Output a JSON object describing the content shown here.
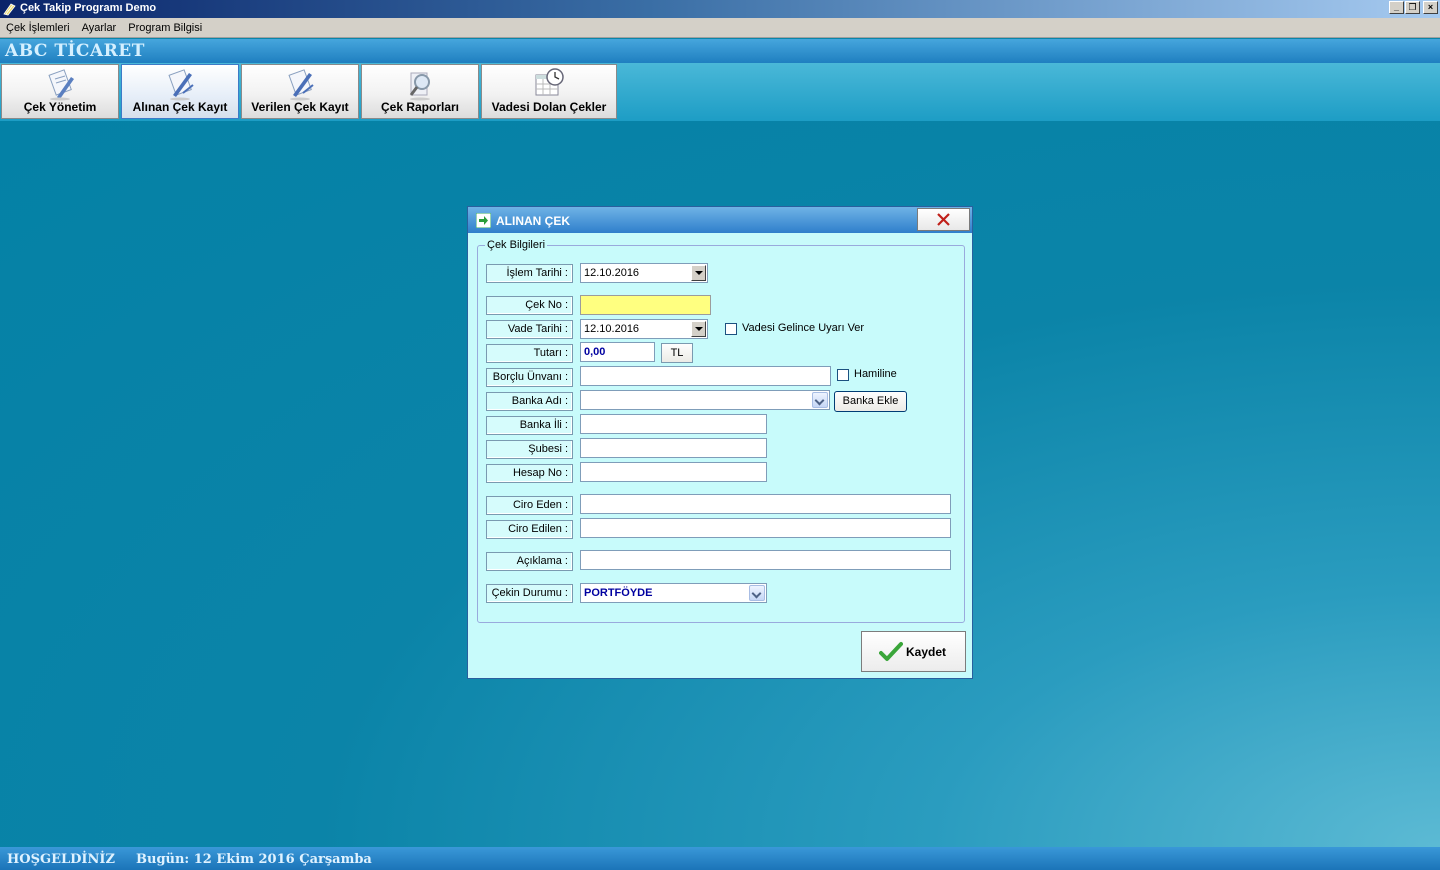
{
  "window": {
    "title": "Çek Takip Programı Demo",
    "controls": [
      "minimize",
      "restore",
      "close"
    ]
  },
  "menu": [
    "Çek İşlemleri",
    "Ayarlar",
    "Program Bilgisi"
  ],
  "company_name": "ABC TİCARET",
  "toolbar": [
    {
      "label": "Çek Yönetim",
      "icon": "document-pencil-icon"
    },
    {
      "label": "Alınan Çek Kayıt",
      "icon": "document-pen-icon"
    },
    {
      "label": "Verilen Çek Kayıt",
      "icon": "document-pen-icon"
    },
    {
      "label": "Çek Raporları",
      "icon": "magnifier-icon"
    },
    {
      "label": "Vadesi Dolan Çekler",
      "icon": "calendar-clock-icon"
    }
  ],
  "status": {
    "welcome": "HOŞGELDİNİZ",
    "today": "Bugün: 12 Ekim 2016 Çarşamba"
  },
  "dialog": {
    "title": "ALINAN ÇEK",
    "group_title": "Çek Bilgileri",
    "labels": {
      "islem_tarihi": "İşlem Tarihi :",
      "cek_no": "Çek No :",
      "vade_tarihi": "Vade Tarihi :",
      "tutari": "Tutarı :",
      "borclu_unvani": "Borçlu Ünvanı :",
      "banka_adi": "Banka Adı :",
      "banka_ili": "Banka İli :",
      "subesi": "Şubesi :",
      "hesap_no": "Hesap No :",
      "ciro_eden": "Ciro Eden :",
      "ciro_edilen": "Ciro Edilen :",
      "aciklama": "Açıklama :",
      "cekin_durumu": "Çekin Durumu :"
    },
    "values": {
      "islem_tarihi": "12.10.2016",
      "cek_no": "",
      "vade_tarihi": "12.10.2016",
      "tutari": "0,00",
      "currency": "TL",
      "borclu_unvani": "",
      "banka_adi": "",
      "banka_ili": "",
      "subesi": "",
      "hesap_no": "",
      "ciro_eden": "",
      "ciro_edilen": "",
      "aciklama": "",
      "cekin_durumu": "PORTFÖYDE"
    },
    "checkboxes": {
      "vade_uyari": {
        "label": "Vadesi Gelince Uyarı Ver",
        "checked": false
      },
      "hamiline": {
        "label": "Hamiline",
        "checked": false
      }
    },
    "banka_ekle_label": "Banka Ekle",
    "save_label": "Kaydet"
  }
}
